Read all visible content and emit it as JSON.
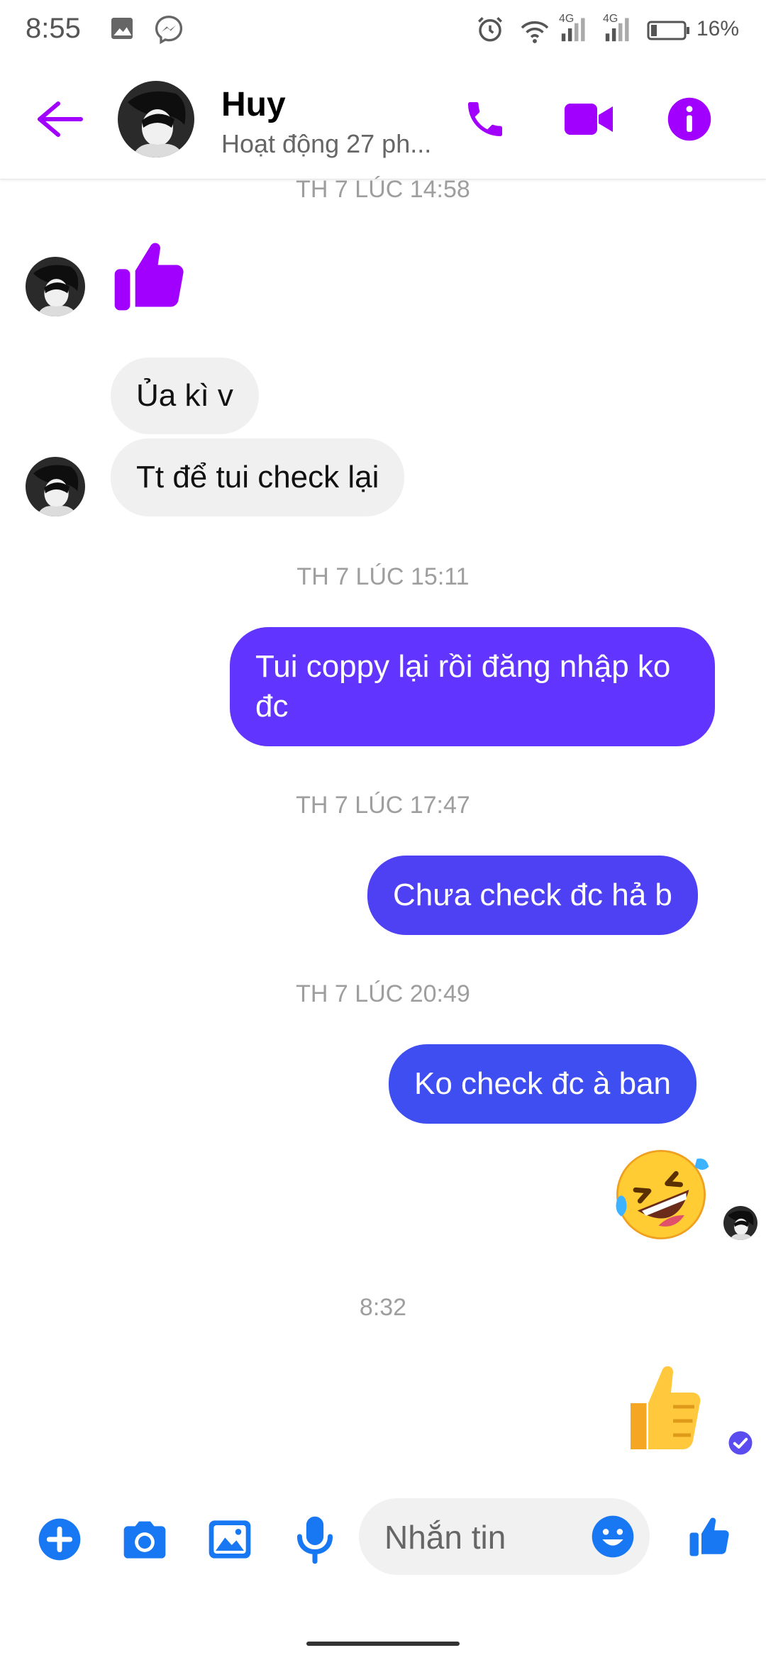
{
  "status_bar": {
    "time": "8:55",
    "network_1": "4G",
    "network_2": "4G",
    "battery": "16%"
  },
  "header": {
    "contact_name": "Huy",
    "contact_status": "Hoạt động 27 ph...",
    "accent_color": "#a100ff"
  },
  "messages": {
    "ts1": "TH 7 LÚC 14:58",
    "in1": "Ủa kì v",
    "in2": "Tt để tui check lại",
    "ts2": "TH 7 LÚC 15:11",
    "out1": "Tui coppy lại rồi đăng nhập ko đc",
    "ts3": "TH 7 LÚC 17:47",
    "out2": "Chưa check đc hả b",
    "ts4": "TH 7 LÚC 20:49",
    "out3": "Ko check đc à ban",
    "ts5": "8:32"
  },
  "composer": {
    "placeholder": "Nhắn tin",
    "icon_color": "#1877f2"
  },
  "colors": {
    "bubble_out_1": "#6134ff",
    "bubble_out_2": "#4e40f3",
    "bubble_out_3": "#3f4ef0",
    "bubble_in": "#f0f0f0"
  }
}
